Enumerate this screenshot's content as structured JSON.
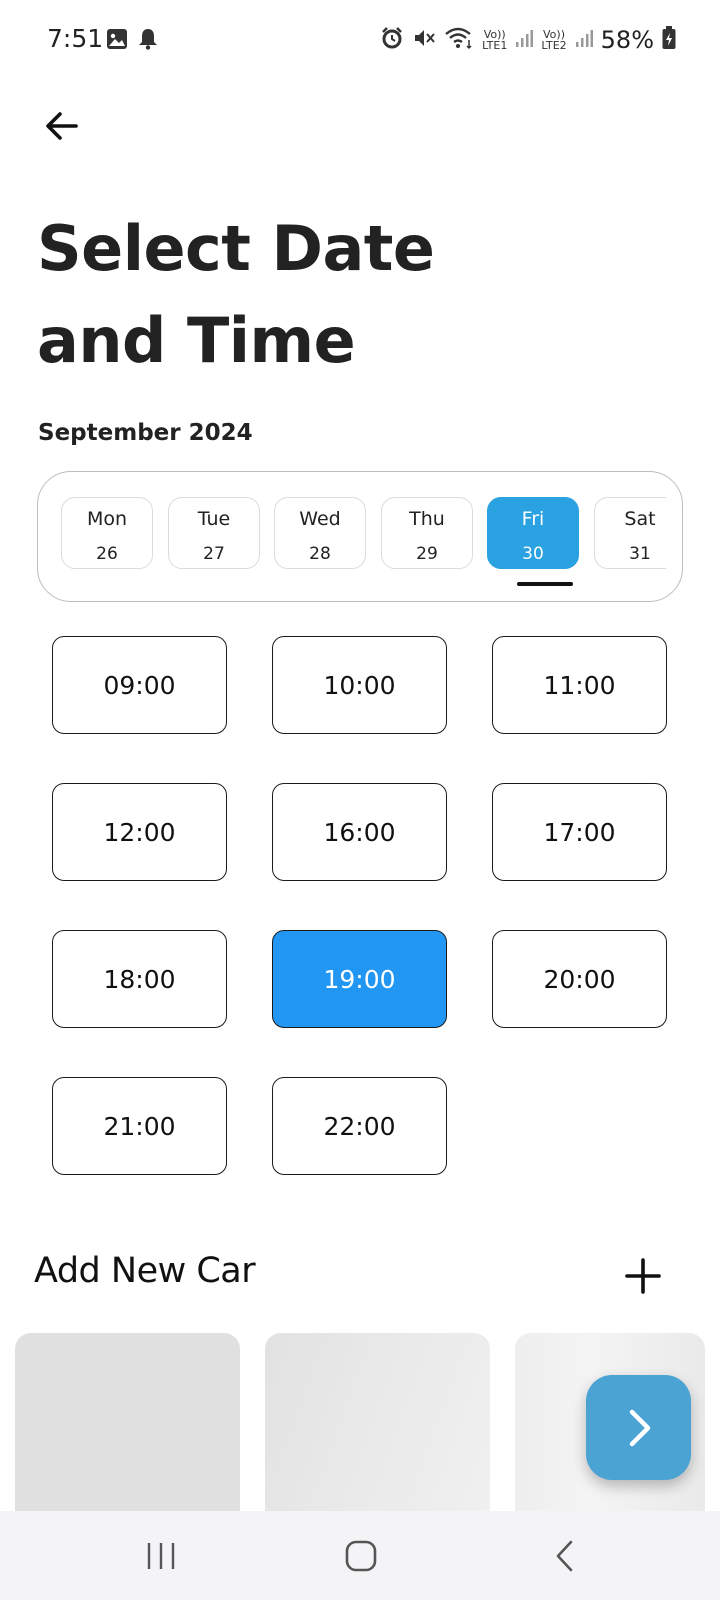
{
  "status_bar": {
    "time": "7:51",
    "battery": "58%",
    "sim1": "LTE1",
    "sim2": "LTE2",
    "volte": "Vo))"
  },
  "header": {
    "back_icon": "arrow-left-icon",
    "title": "Select Date and Time"
  },
  "calendar": {
    "month": "September 2024",
    "days": [
      {
        "name": "Mon",
        "date": "26"
      },
      {
        "name": "Tue",
        "date": "27"
      },
      {
        "name": "Wed",
        "date": "28"
      },
      {
        "name": "Thu",
        "date": "29"
      },
      {
        "name": "Fri",
        "date": "30"
      },
      {
        "name": "Sat",
        "date": "31"
      }
    ],
    "selected_day": "Fri"
  },
  "time_slots": {
    "slots": [
      "09:00",
      "10:00",
      "11:00",
      "12:00",
      "16:00",
      "17:00",
      "18:00",
      "19:00",
      "20:00",
      "21:00",
      "22:00"
    ],
    "selected": "19:00"
  },
  "cars": {
    "title": "Add New Car",
    "add_icon": "plus-icon",
    "card_count_visible": 3
  },
  "fab": {
    "icon": "chevron-right-icon"
  },
  "colors": {
    "accent_day": "#2aa1e0",
    "accent_time": "#2196f3",
    "fab": "#4ba3d3"
  },
  "nav": {
    "recents_icon": "recents-icon",
    "home_icon": "home-icon",
    "back_icon": "back-icon"
  }
}
